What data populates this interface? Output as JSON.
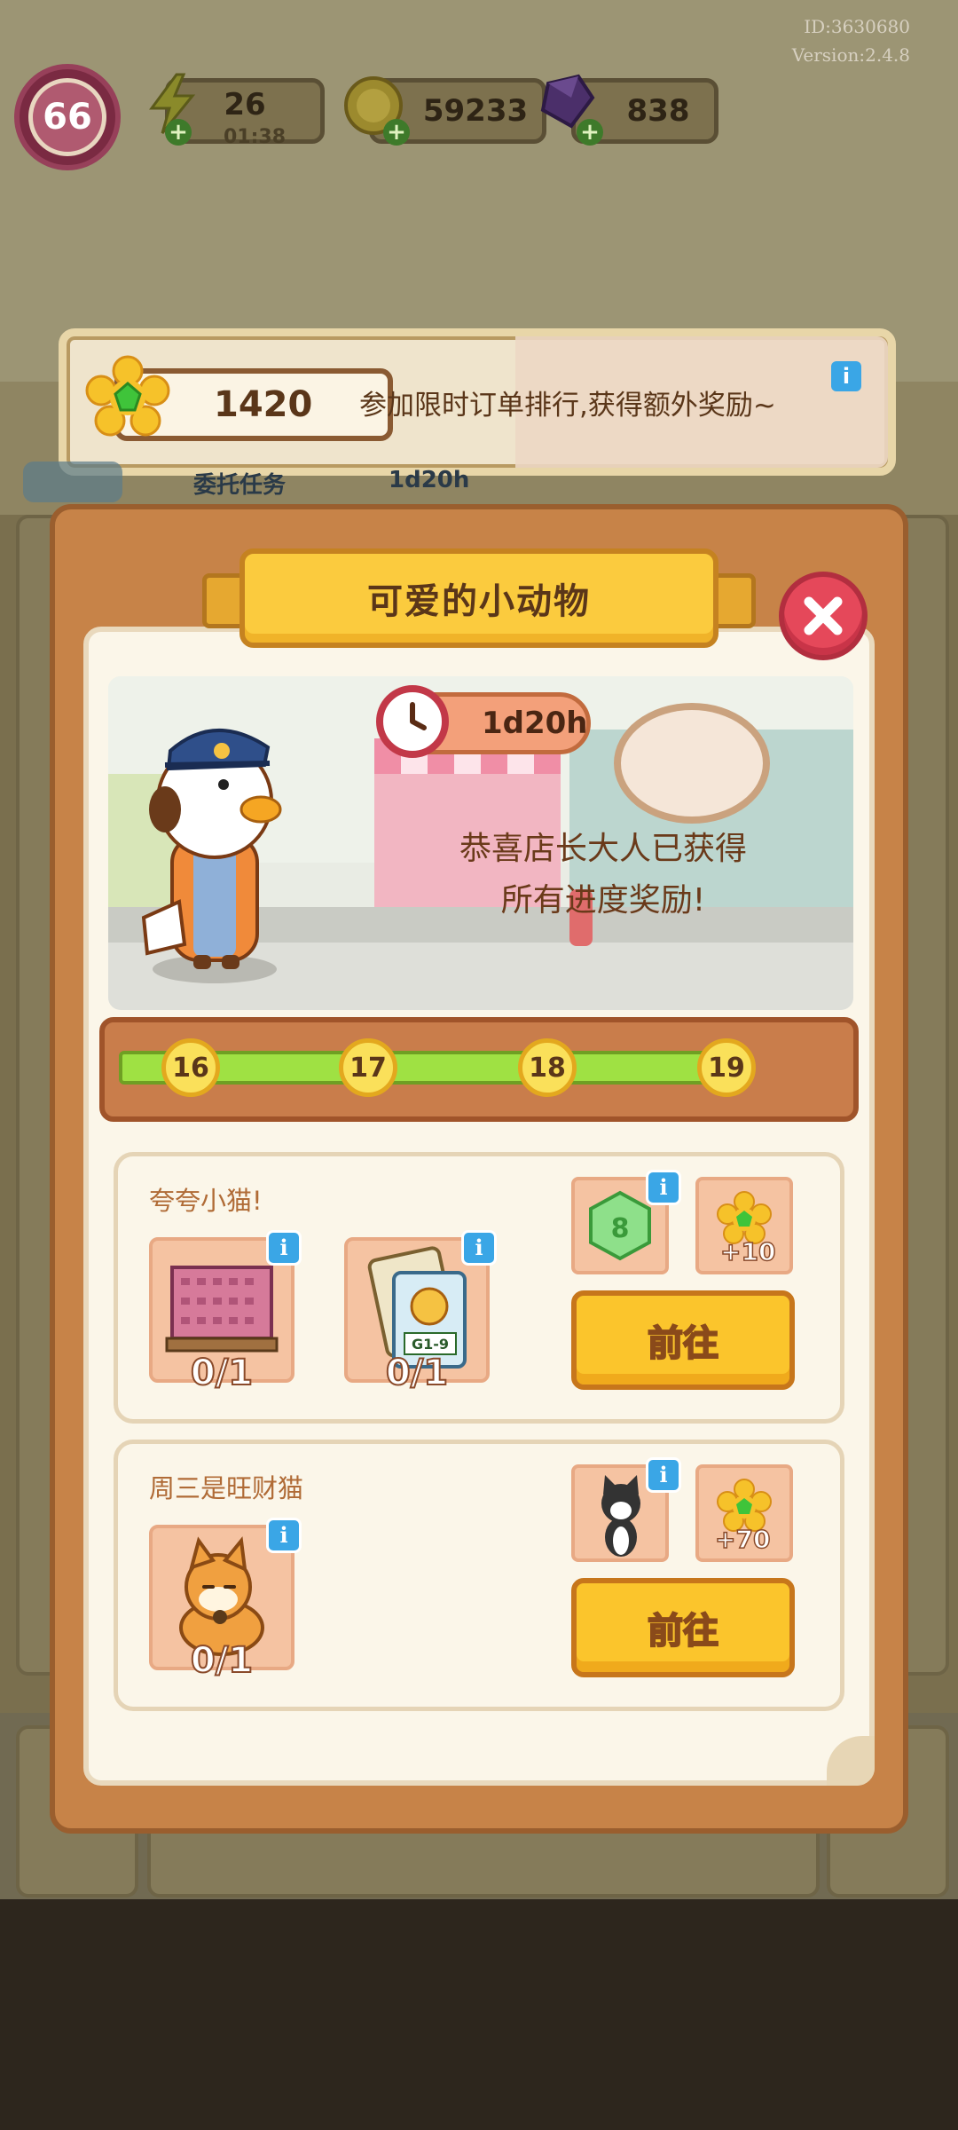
{
  "header": {
    "player_id": "ID:3630680",
    "version": "Version:2.4.8",
    "level": "66",
    "energy": {
      "value": "26",
      "timer": "01:38",
      "icon": "lightning-icon"
    },
    "coins": {
      "value": "59233",
      "icon": "coin-icon"
    },
    "gems": {
      "value": "838",
      "icon": "gem-icon"
    }
  },
  "banner": {
    "points": "1420",
    "message": "参加限时订单排行,获得额外奖励~",
    "info": "i"
  },
  "behind_tabs": {
    "left_label": "委托任务",
    "right_label": "1d20h"
  },
  "panel": {
    "title": "可爱的小动物",
    "close_icon": "close-icon",
    "timer": "1d20h",
    "congrats_line1": "恭喜店长大人已获得",
    "congrats_line2": "所有进度奖励!"
  },
  "progress": {
    "milestones": [
      "16",
      "17",
      "18",
      "19"
    ],
    "fill_fraction": 1.0,
    "colors": {
      "fill": "#9fe143",
      "frame": "#c97d4b"
    }
  },
  "tasks": [
    {
      "name": "夸夸小猫!",
      "items": [
        {
          "icon": "brick-pallet-icon",
          "count": "0/1",
          "info": "i"
        },
        {
          "icon": "poster-g1-9-icon",
          "label": "G1-9",
          "count": "0/1",
          "info": "i"
        }
      ],
      "rewards": [
        {
          "icon": "green-hexagon-icon",
          "info": "i"
        },
        {
          "icon": "flower-points-icon",
          "amount": "+10"
        }
      ],
      "button": "前往"
    },
    {
      "name": "周三是旺财猫",
      "items": [
        {
          "icon": "shiba-dog-icon",
          "count": "0/1",
          "info": "i"
        }
      ],
      "rewards": [
        {
          "icon": "tuxedo-cat-icon",
          "info": "i"
        },
        {
          "icon": "flower-points-icon",
          "amount": "+70"
        }
      ],
      "button": "前往"
    }
  ],
  "colors": {
    "accent_yellow": "#fbc52c",
    "close_red": "#e5485a",
    "panel_brown": "#c78348",
    "info_blue": "#3aa6e6"
  }
}
